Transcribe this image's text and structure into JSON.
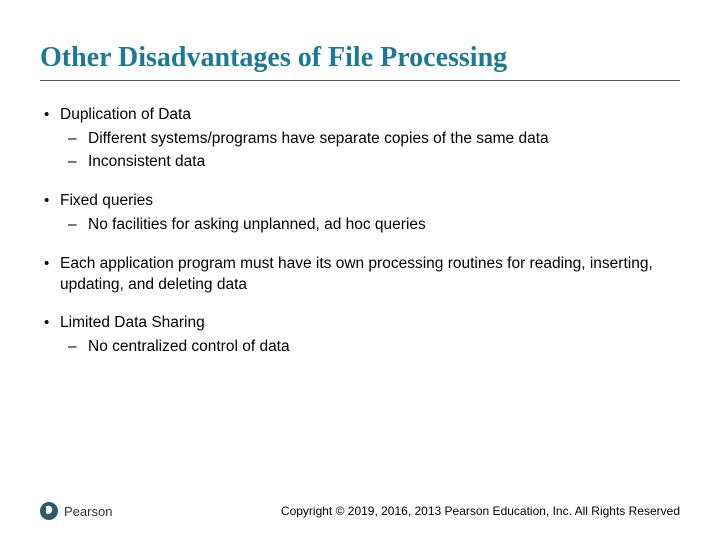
{
  "title": "Other Disadvantages of File Processing",
  "bullets": [
    {
      "text": "Duplication of Data",
      "sub": [
        "Different systems/programs have separate copies of the same data",
        "Inconsistent data"
      ]
    },
    {
      "text": "Fixed queries",
      "sub": [
        "No facilities for asking unplanned, ad hoc queries"
      ]
    },
    {
      "text": "Each application program must have its own processing routines for reading, inserting, updating, and deleting data",
      "sub": []
    },
    {
      "text": "Limited Data Sharing",
      "sub": [
        "No centralized control of data"
      ]
    }
  ],
  "brand": "Pearson",
  "copyright": "Copyright © 2019, 2016, 2013 Pearson Education, Inc. All Rights Reserved"
}
